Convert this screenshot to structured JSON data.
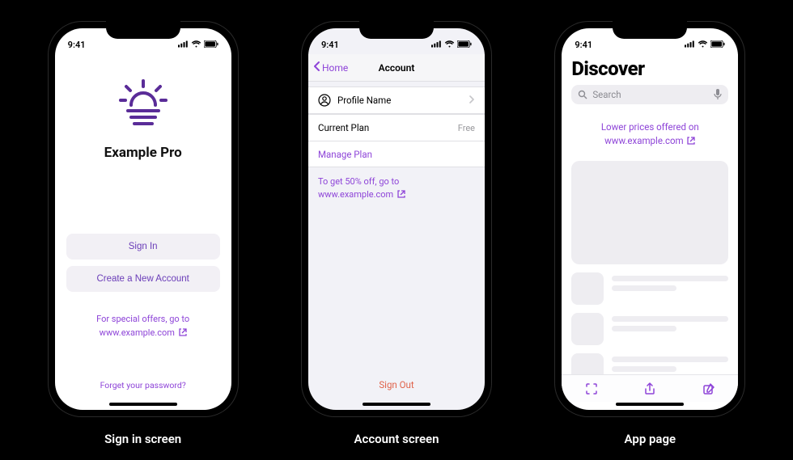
{
  "status": {
    "time": "9:41"
  },
  "captions": {
    "signin": "Sign in screen",
    "account": "Account screen",
    "apppage": "App page"
  },
  "screen1": {
    "app_title": "Example Pro",
    "signin": "Sign In",
    "create": "Create a New Account",
    "offer_line1": "For special offers, go to",
    "offer_line2": "www.example.com",
    "forget": "Forget your password?"
  },
  "screen2": {
    "back_label": "Home",
    "title": "Account",
    "profile_label": "Profile Name",
    "plan_label": "Current Plan",
    "plan_value": "Free",
    "manage": "Manage Plan",
    "foot_line1": "To get 50% off, go to",
    "foot_line2": "www.example.com",
    "signout": "Sign Out"
  },
  "screen3": {
    "title": "Discover",
    "search_placeholder": "Search",
    "promo_line1": "Lower prices offered on",
    "promo_line2": "www.example.com"
  }
}
